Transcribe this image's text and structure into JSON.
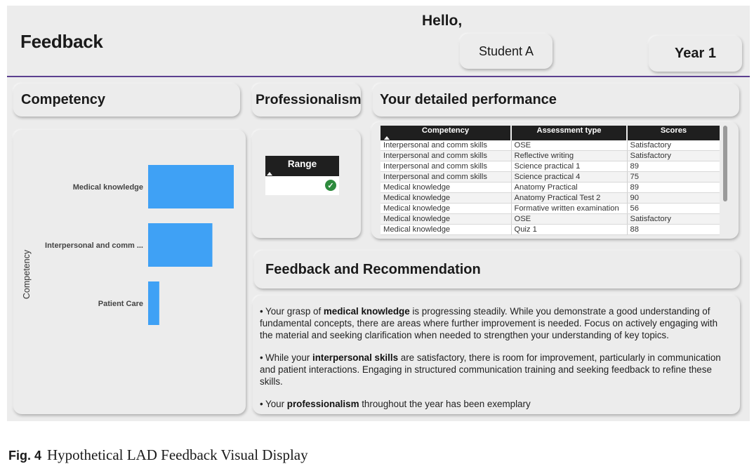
{
  "header": {
    "page_title": "Feedback",
    "greeting": "Hello,",
    "student_button": "Student A",
    "year_button": "Year 1"
  },
  "sections": {
    "competency": "Competency",
    "professionalism": "Professionalism",
    "performance": "Your detailed performance",
    "feedback": "Feedback and Recommendation"
  },
  "chart_data": {
    "type": "bar",
    "orientation": "horizontal",
    "ylabel": "Competency",
    "categories": [
      "Medical knowledge",
      "Interpersonal and comm ...",
      "Patient Care"
    ],
    "values": [
      100,
      75,
      13
    ],
    "bar_color": "#3fa1f5"
  },
  "range": {
    "header": "Range",
    "status_icon": "check-circle-icon",
    "status_color": "#2e8b3e"
  },
  "table": {
    "columns": [
      "Competency",
      "Assessment type",
      "Scores"
    ],
    "rows": [
      [
        "Interpersonal and comm skills",
        "OSE",
        "Satisfactory"
      ],
      [
        "Interpersonal and comm skills",
        "Reflective writing",
        "Satisfactory"
      ],
      [
        "Interpersonal and comm skills",
        "Science practical 1",
        "89"
      ],
      [
        "Interpersonal and comm skills",
        "Science practical 4",
        "75"
      ],
      [
        "Medical knowledge",
        "Anatomy Practical",
        "89"
      ],
      [
        "Medical knowledge",
        "Anatomy Practical Test 2",
        "90"
      ],
      [
        "Medical knowledge",
        "Formative written examination",
        "56"
      ],
      [
        "Medical knowledge",
        "OSE",
        "Satisfactory"
      ],
      [
        "Medical knowledge",
        "Quiz 1",
        "88"
      ]
    ]
  },
  "feedback": [
    {
      "pre": "Your grasp of ",
      "bold": "medical knowledge",
      "post": " is progressing steadily. While you demonstrate a good understanding of fundamental concepts, there are areas where further improvement is needed. Focus on actively engaging with the material and seeking clarification when needed to strengthen your understanding of key topics."
    },
    {
      "pre": "While your ",
      "bold": "interpersonal skills",
      "post": " are satisfactory, there is room for improvement, particularly in communication and patient interactions. Engaging in structured communication training and seeking feedback to refine these skills."
    },
    {
      "pre": "Your ",
      "bold": "professionalism",
      "post": " throughout the year has been exemplary"
    }
  ],
  "caption": {
    "label": "Fig. 4",
    "text": "Hypothetical LAD Feedback Visual Display"
  }
}
